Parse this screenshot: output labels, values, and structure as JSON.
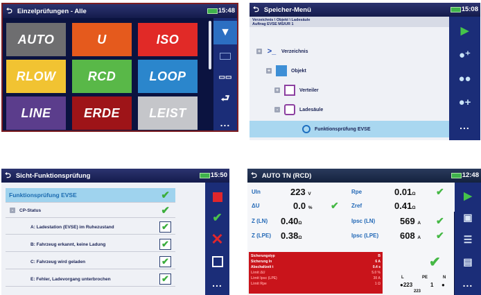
{
  "screen1": {
    "title": "Einzelprüfungen - Alle",
    "time": "15:48",
    "tiles": [
      {
        "label": "AUTO",
        "color": "#6e6e70"
      },
      {
        "label": "U",
        "color": "#e55a1d"
      },
      {
        "label": "ISO",
        "color": "#e12a27"
      },
      {
        "label": "RLOW",
        "color": "#f1c332"
      },
      {
        "label": "RCD",
        "color": "#59b848"
      },
      {
        "label": "LOOP",
        "color": "#2b86cc"
      },
      {
        "label": "LINE",
        "color": "#5b3d8c"
      },
      {
        "label": "ERDE",
        "color": "#9e1418"
      },
      {
        "label": "LEIST",
        "color": "#c5c6ca"
      }
    ],
    "more": "..."
  },
  "screen2": {
    "title": "Speicher-Menü",
    "time": "15:08",
    "breadcrumb": "Verzeichnis \\ Objekt \\ Ladesäule",
    "breadcrumb_sub": "Auftrag EVSE MS/UR 1",
    "nodes": [
      {
        "label": "Verzeichnis",
        "icon": ">_",
        "expander": "+"
      },
      {
        "label": "Objekt",
        "icon": "object-icon",
        "expander": "+"
      },
      {
        "label": "Verteiler",
        "icon": "distributor-icon",
        "expander": "+"
      },
      {
        "label": "Ladesäule",
        "icon": "charger-icon",
        "expander": "-"
      },
      {
        "label": "Funktionsprüfung EVSE",
        "icon": "circle-icon",
        "expander": ""
      }
    ],
    "more": "..."
  },
  "screen3": {
    "title": "Sicht-Funktionsprüfung",
    "time": "15:50",
    "header_item": "Funktionsprüfung EVSE",
    "group_label": "CP-Status",
    "items": [
      "A: Ladestation (EVSE) im Ruhezustand",
      "B: Fahrzeug erkannt, keine Ladung",
      "C: Fahrzeug wird geladen",
      "E: Fehler, Ladevorgang unterbrochen"
    ],
    "more": "..."
  },
  "screen4": {
    "title": "AUTO TN (RCD)",
    "time": "12:48",
    "left_results": [
      {
        "label": "Uln",
        "value": "223",
        "unit": "V"
      },
      {
        "label": "ΔU",
        "value": "0.0",
        "unit": "%"
      },
      {
        "label": "Z (LN)",
        "value": "0.40",
        "unit": "Ω"
      },
      {
        "label": "Z (LPE)",
        "value": "0.38",
        "unit": "Ω"
      }
    ],
    "right_results": [
      {
        "label": "Rpe",
        "value": "0.01",
        "unit": "Ω"
      },
      {
        "label": "Zref",
        "value": "0.41",
        "unit": "Ω"
      },
      {
        "label": "Ipsc (LN)",
        "value": "569",
        "unit": "A"
      },
      {
        "label": "Ipsc (LPE)",
        "value": "608",
        "unit": "A"
      }
    ],
    "log": [
      {
        "label": "Sicherungstyp",
        "value": "B"
      },
      {
        "label": "Sicherung In",
        "value": "6 A"
      },
      {
        "label": "Abschaltzeit t",
        "value": "0.4 s"
      },
      {
        "label": "Limit ΔU",
        "value": "5.0 %"
      },
      {
        "label": "Limit Ipsc (LPE)",
        "value": "30 A"
      },
      {
        "label": "Limit Rpe",
        "value": "1 Ω"
      }
    ],
    "diagram_value": "223",
    "diagram_left": "L",
    "diagram_mid": "PE",
    "diagram_right": "N",
    "diagram_one": "1",
    "diagram_bottom": "223",
    "more": "..."
  }
}
